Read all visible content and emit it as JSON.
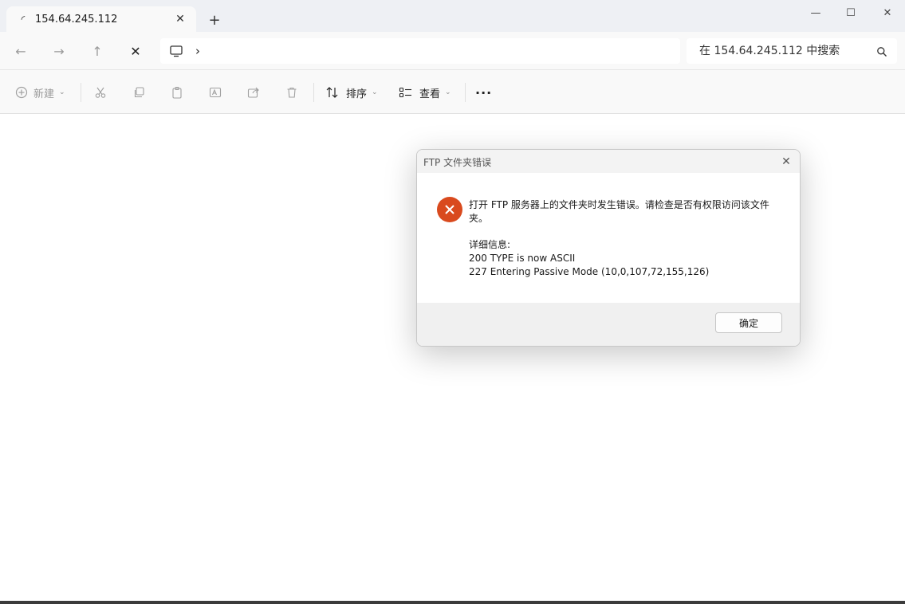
{
  "tab": {
    "title": "154.64.245.112",
    "close_glyph": "✕",
    "new_tab_glyph": "+"
  },
  "window_controls": {
    "minimize": "—",
    "maximize": "☐",
    "close": "✕"
  },
  "nav": {
    "back": "←",
    "forward": "→",
    "up": "↑",
    "stop": "✕",
    "breadcrumb_separator": "›"
  },
  "search": {
    "placeholder": "在 154.64.245.112 中搜索"
  },
  "toolbar": {
    "new_label": "新建",
    "sort_label": "排序",
    "view_label": "查看",
    "more_label": "···",
    "chevron": "⌄"
  },
  "dialog": {
    "title": "FTP 文件夹错误",
    "message": "打开 FTP 服务器上的文件夹时发生错误。请检查是否有权限访问该文件夹。",
    "details_label": "详细信息:",
    "detail_lines": [
      "200 TYPE is now ASCII",
      "227 Entering Passive Mode (10,0,107,72,155,126)"
    ],
    "ok_label": "确定",
    "close_glyph": "✕"
  },
  "colors": {
    "error": "#d94a1e",
    "titlebar": "#eef0f4",
    "toolbar": "#f9f9f9"
  }
}
